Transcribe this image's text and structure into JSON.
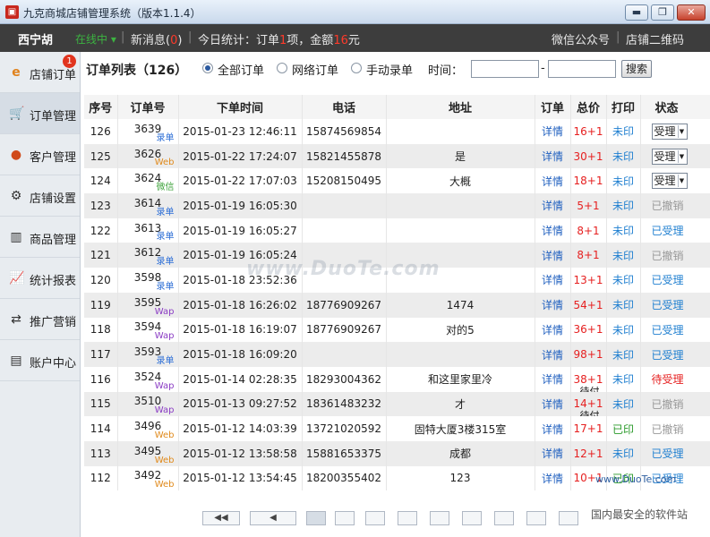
{
  "window": {
    "title": "九克商城店铺管理系统（版本1.1.4）",
    "app_icon": "gift-icon",
    "controls": [
      "minimize",
      "maximize",
      "close"
    ]
  },
  "topbar": {
    "shop_name": "西宁胡",
    "online_label": "在线中",
    "news_label": "新消息",
    "news_open": "(",
    "news_count": "0",
    "news_close": ")",
    "stats_prefix": "今日统计：订单",
    "stats_orders": "1",
    "stats_mid": "项，金额",
    "stats_amount": "16",
    "stats_unit": "元",
    "wechat_link": "微信公众号",
    "qrcode_link": "店铺二维码"
  },
  "sidebar": {
    "items": [
      {
        "label": "店铺订单",
        "icon": "ie-icon",
        "badge": "1"
      },
      {
        "label": "订单管理",
        "icon": "cart-icon"
      },
      {
        "label": "客户管理",
        "icon": "chat-icon"
      },
      {
        "label": "店铺设置",
        "icon": "gear-icon"
      },
      {
        "label": "商品管理",
        "icon": "barcode-icon"
      },
      {
        "label": "统计报表",
        "icon": "chart-icon"
      },
      {
        "label": "推广营销",
        "icon": "share-icon"
      },
      {
        "label": "账户中心",
        "icon": "card-icon"
      }
    ]
  },
  "toolbar": {
    "title": "订单列表（126）",
    "filter_all": "全部订单",
    "filter_online": "网络订单",
    "filter_manual": "手动录单",
    "time_label": "时间：",
    "date_sep": "-",
    "search_button": "搜索"
  },
  "table": {
    "headers": [
      "序号",
      "订单号",
      "下单时间",
      "电话",
      "地址",
      "订单",
      "总价",
      "打印",
      "状态"
    ],
    "rows": [
      {
        "seq": "126",
        "order_no": "3639",
        "source": "录单",
        "time": "2015-01-23 12:46:11",
        "phone": "15874569854",
        "address": "",
        "detail": "详情",
        "total": "16+1",
        "note": "",
        "print": "未印",
        "status": "受理"
      },
      {
        "seq": "125",
        "order_no": "3626",
        "source": "Web",
        "time": "2015-01-22 17:24:07",
        "phone": "15821455878",
        "address": "是",
        "detail": "详情",
        "total": "30+1",
        "note": "",
        "print": "未印",
        "status": "受理"
      },
      {
        "seq": "124",
        "order_no": "3624",
        "source": "微信",
        "time": "2015-01-22 17:07:03",
        "phone": "15208150495",
        "address": "大概",
        "detail": "详情",
        "total": "18+1",
        "note": "",
        "print": "未印",
        "status": "受理"
      },
      {
        "seq": "123",
        "order_no": "3614",
        "source": "录单",
        "time": "2015-01-19 16:05:30",
        "phone": "",
        "address": "",
        "detail": "详情",
        "total": "5+1",
        "note": "",
        "print": "未印",
        "status": "已撤销"
      },
      {
        "seq": "122",
        "order_no": "3613",
        "source": "录单",
        "time": "2015-01-19 16:05:27",
        "phone": "",
        "address": "",
        "detail": "详情",
        "total": "8+1",
        "note": "",
        "print": "未印",
        "status": "已受理"
      },
      {
        "seq": "121",
        "order_no": "3612",
        "source": "录单",
        "time": "2015-01-19 16:05:24",
        "phone": "",
        "address": "",
        "detail": "详情",
        "total": "8+1",
        "note": "",
        "print": "未印",
        "status": "已撤销"
      },
      {
        "seq": "120",
        "order_no": "3598",
        "source": "录单",
        "time": "2015-01-18 23:52:36",
        "phone": "",
        "address": "",
        "detail": "详情",
        "total": "13+1",
        "note": "",
        "print": "未印",
        "status": "已受理"
      },
      {
        "seq": "119",
        "order_no": "3595",
        "source": "Wap",
        "time": "2015-01-18 16:26:02",
        "phone": "18776909267",
        "address": "1474",
        "detail": "详情",
        "total": "54+1",
        "note": "",
        "print": "未印",
        "status": "已受理"
      },
      {
        "seq": "118",
        "order_no": "3594",
        "source": "Wap",
        "time": "2015-01-18 16:19:07",
        "phone": "18776909267",
        "address": "对的5",
        "detail": "详情",
        "total": "36+1",
        "note": "",
        "print": "未印",
        "status": "已受理"
      },
      {
        "seq": "117",
        "order_no": "3593",
        "source": "录单",
        "time": "2015-01-18 16:09:20",
        "phone": "",
        "address": "",
        "detail": "详情",
        "total": "98+1",
        "note": "",
        "print": "未印",
        "status": "已受理"
      },
      {
        "seq": "116",
        "order_no": "3524",
        "source": "Wap",
        "time": "2015-01-14 02:28:35",
        "phone": "18293004362",
        "address": "和这里家里冷",
        "detail": "详情",
        "total": "38+1",
        "note": "待付",
        "print": "未印",
        "status": "待受理"
      },
      {
        "seq": "115",
        "order_no": "3510",
        "source": "Wap",
        "time": "2015-01-13 09:27:52",
        "phone": "18361483232",
        "address": "才",
        "detail": "详情",
        "total": "14+1",
        "note": "待付",
        "print": "未印",
        "status": "已撤销"
      },
      {
        "seq": "114",
        "order_no": "3496",
        "source": "Web",
        "time": "2015-01-12 14:03:39",
        "phone": "13721020592",
        "address": "固特大厦3楼315室",
        "detail": "详情",
        "total": "17+1",
        "note": "",
        "print": "已印",
        "status": "已撤销"
      },
      {
        "seq": "113",
        "order_no": "3495",
        "source": "Web",
        "time": "2015-01-12 13:58:58",
        "phone": "15881653375",
        "address": "成都",
        "detail": "详情",
        "total": "12+1",
        "note": "",
        "print": "未印",
        "status": "已受理"
      },
      {
        "seq": "112",
        "order_no": "3492",
        "source": "Web",
        "time": "2015-01-12 13:54:45",
        "phone": "18200355402",
        "address": "123",
        "detail": "详情",
        "total": "10+1",
        "note": "",
        "print": "已印",
        "status": "已受理"
      }
    ]
  },
  "watermark": {
    "text": "www.DuoTe.com",
    "site": "www.DuoTe.com",
    "slogan": "国内最安全的软件站"
  },
  "colors": {
    "accent_blue": "#1f5fbf",
    "price_red": "#e62020",
    "printed_green": "#2a9a2a",
    "topbar_bg": "#3d3d3d"
  }
}
